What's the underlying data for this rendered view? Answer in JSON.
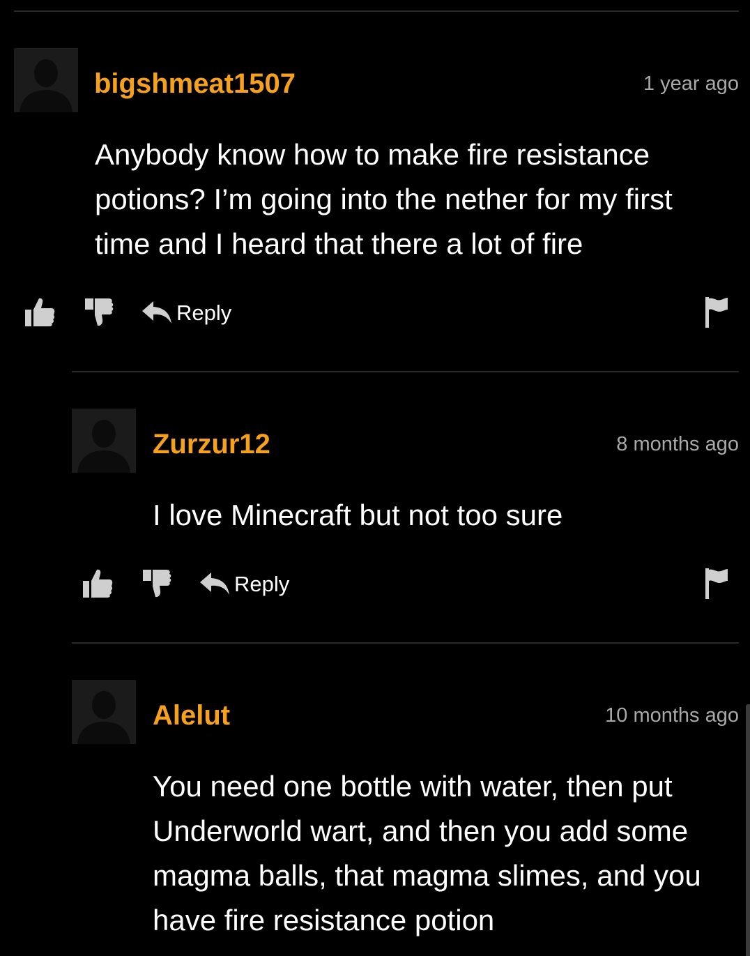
{
  "comments": [
    {
      "username": "bigshmeat1507",
      "timestamp": "1 year ago",
      "text": "Anybody know how to make fire resistance potions? I’m going into the nether for my first time and I heard that there a lot of fire",
      "reply_label": "Reply",
      "icons": {
        "avatar": "avatar-placeholder-icon",
        "like": "thumbs-up-icon",
        "dislike": "thumbs-down-icon",
        "reply": "reply-arrow-icon",
        "flag": "flag-icon"
      }
    },
    {
      "username": "Zurzur12",
      "timestamp": "8 months ago",
      "text": "I love Minecraft but not too sure",
      "reply_label": "Reply",
      "icons": {
        "avatar": "avatar-placeholder-icon",
        "like": "thumbs-up-icon",
        "dislike": "thumbs-down-icon",
        "reply": "reply-arrow-icon",
        "flag": "flag-icon"
      }
    },
    {
      "username": "Alelut",
      "timestamp": "10 months ago",
      "text": "You need one bottle with water, then put Underworld wart, and then you add some magma balls, that magma slimes, and you have fire resistance potion",
      "icons": {
        "avatar": "avatar-placeholder-icon"
      }
    }
  ],
  "colors": {
    "background": "#000000",
    "username": "#f5a11d",
    "timestamp": "#a9a9a9",
    "text": "#ffffff",
    "icon": "#cfcfcf",
    "divider": "#2a2a2a"
  }
}
